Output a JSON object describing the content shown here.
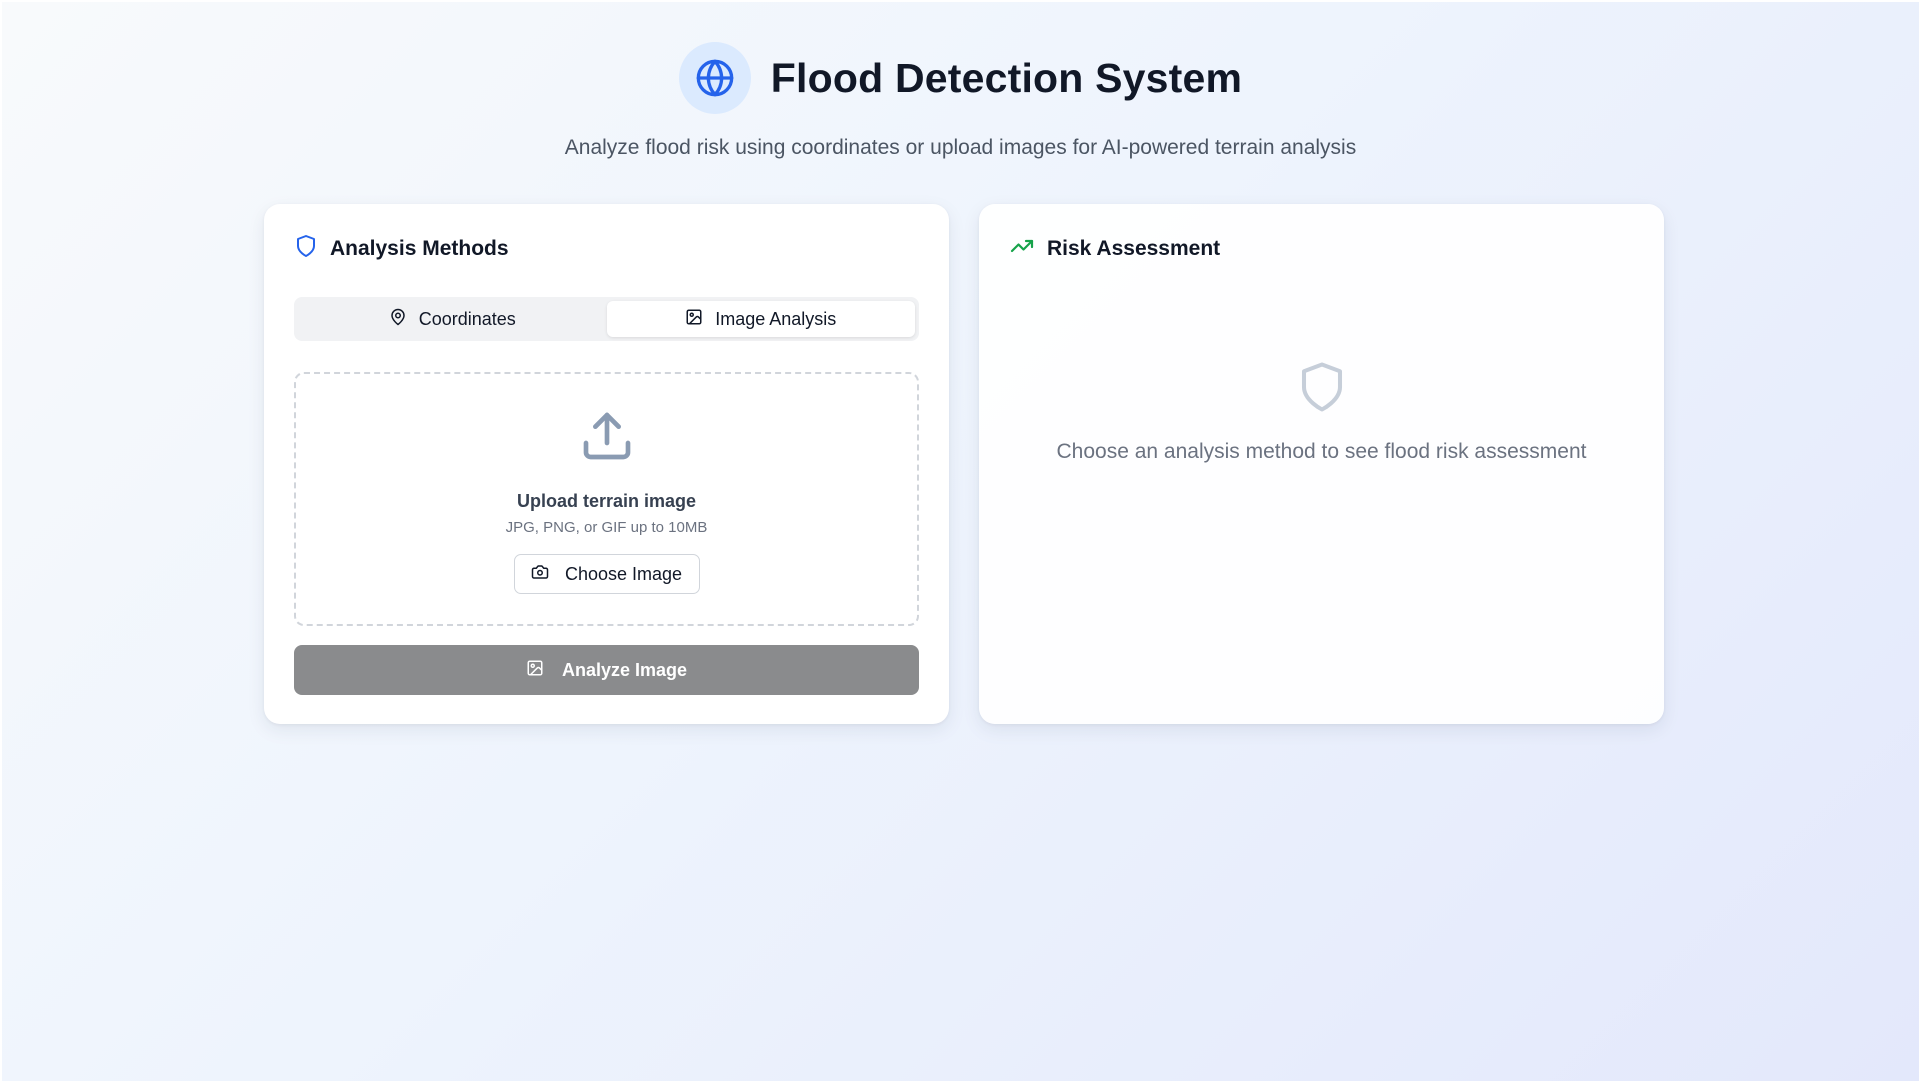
{
  "header": {
    "title": "Flood Detection System",
    "subtitle": "Analyze flood risk using coordinates or upload images for AI-powered terrain analysis",
    "icon": "globe-icon"
  },
  "analysis": {
    "title": "Analysis Methods",
    "icon": "shield-icon",
    "tabs": [
      {
        "label": "Coordinates",
        "icon": "map-pin-icon",
        "active": false
      },
      {
        "label": "Image Analysis",
        "icon": "image-icon",
        "active": true
      }
    ],
    "upload": {
      "title": "Upload terrain image",
      "hint": "JPG, PNG, or GIF up to 10MB",
      "button_label": "Choose Image",
      "icon": "upload-icon"
    },
    "analyze_button": "Analyze Image"
  },
  "risk": {
    "title": "Risk Assessment",
    "icon": "trending-up-icon",
    "empty_message": "Choose an analysis method to see flood risk assessment"
  },
  "colors": {
    "accent_blue": "#2563eb",
    "accent_green": "#16a34a",
    "disabled_button": "#8a8b8d"
  }
}
